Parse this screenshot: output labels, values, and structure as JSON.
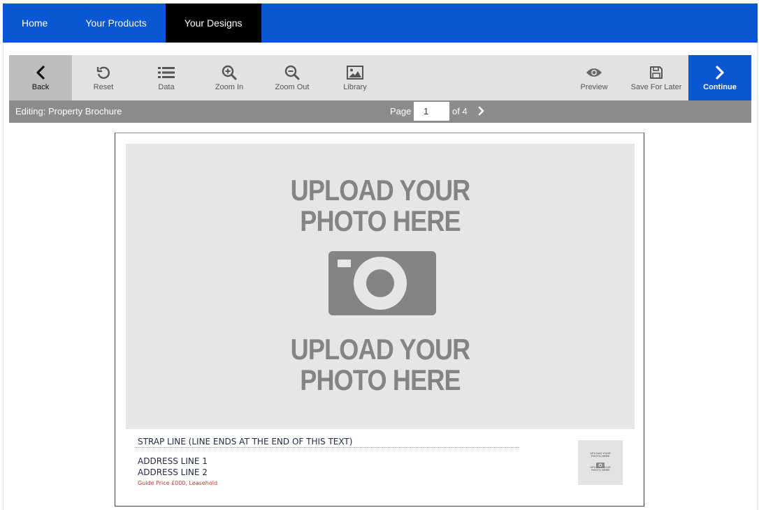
{
  "nav": {
    "tabs": [
      {
        "label": "Home"
      },
      {
        "label": "Your Products"
      },
      {
        "label": "Your Designs"
      }
    ]
  },
  "toolbar": {
    "back": "Back",
    "reset": "Reset",
    "data": "Data",
    "zoom_in": "Zoom In",
    "zoom_out": "Zoom Out",
    "library": "Library",
    "preview": "Preview",
    "save_for_later": "Save For Later",
    "continue": "Continue"
  },
  "status": {
    "editing": "Editing: Property Brochure",
    "page_label": "Page",
    "page_value": "1",
    "page_of": "of 4"
  },
  "document": {
    "photo_line1": "UPLOAD YOUR",
    "photo_line2": "PHOTO HERE",
    "strap_line": "STRAP LINE (LINE ENDS AT THE END OF THIS TEXT)",
    "address_line1": "ADDRESS LINE 1",
    "address_line2": "ADDRESS LINE 2",
    "guide_price": "Guide Price £000, Leasehold"
  },
  "colors": {
    "nav_blue": "#0a57d3",
    "active_tab": "#000000",
    "toolbar_bg": "#e2e2e2",
    "status_bar": "#8c8c8c",
    "placeholder": "#848484",
    "guide_price": "#c0392b"
  }
}
